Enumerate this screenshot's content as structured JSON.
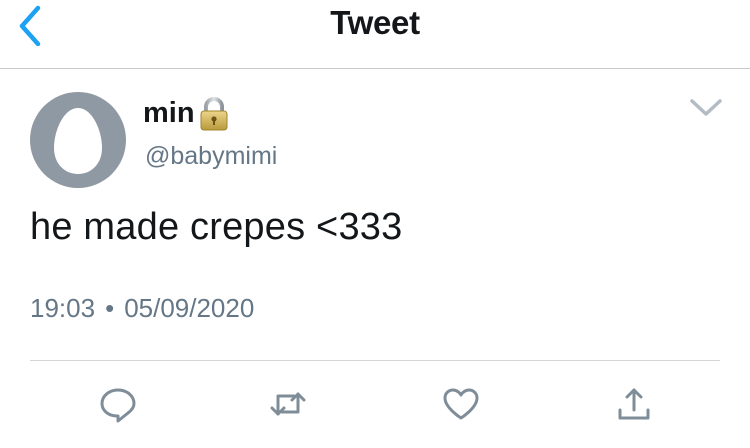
{
  "navbar": {
    "title": "Tweet",
    "back_icon": "chevron-left-icon"
  },
  "tweet": {
    "display_name": "min",
    "lock_icon": "lock-icon",
    "handle": "@babymimi",
    "text": "he made crepes <333",
    "time": "19:03",
    "separator": "•",
    "date": "05/09/2020",
    "menu_icon": "chevron-down-icon"
  },
  "actions": {
    "reply_icon": "reply-icon",
    "retweet_icon": "retweet-icon",
    "like_icon": "heart-icon",
    "share_icon": "share-icon"
  },
  "colors": {
    "accent": "#1da1f2",
    "text": "#14171a",
    "secondary": "#657786",
    "avatar": "#8f99a3",
    "icon": "#7f8d99"
  }
}
